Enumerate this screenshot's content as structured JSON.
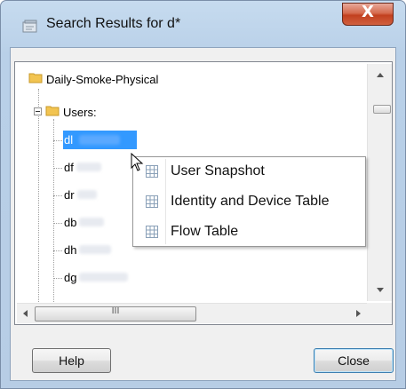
{
  "window": {
    "title": "Search Results for d*",
    "close_glyph": "X"
  },
  "tree": {
    "root": "Daily-Smoke-Physical",
    "group_label": "Users:",
    "items": [
      {
        "label": "dl",
        "selected": true
      },
      {
        "label": "df",
        "selected": false
      },
      {
        "label": "dr",
        "selected": false
      },
      {
        "label": "db",
        "selected": false
      },
      {
        "label": "dh",
        "selected": false
      },
      {
        "label": "dg",
        "selected": false
      }
    ],
    "expand_glyph": "⊟",
    "hscroll_thumb_grip": "III"
  },
  "context_menu": {
    "items": [
      {
        "label": "User Snapshot",
        "icon": "table-icon"
      },
      {
        "label": "Identity and Device Table",
        "icon": "table-icon"
      },
      {
        "label": "Flow Table",
        "icon": "table-icon"
      }
    ]
  },
  "buttons": {
    "help": "Help",
    "close": "Close"
  },
  "colors": {
    "selection": "#3399ff",
    "folder": "#f2c451",
    "title_bar": "#c6dbef"
  }
}
